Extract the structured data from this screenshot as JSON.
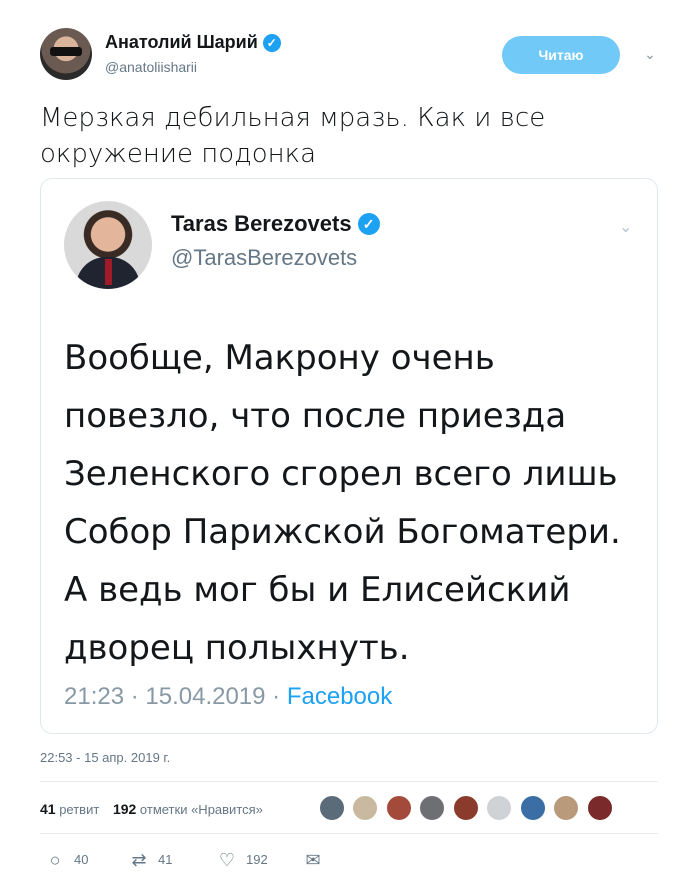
{
  "author": {
    "name": "Анатолий Шарий",
    "handle": "@anatoliisharii",
    "follow_label": "Читаю"
  },
  "tweet": {
    "text": "Мерзкая дебильная мразь. Как и все окружение подонка",
    "timestamp": "22:53 - 15 апр. 2019 г."
  },
  "quoted": {
    "name": "Taras Berezovets",
    "handle": "@TarasBerezovets",
    "body": "Вообще, Макрону очень повезло, что после приезда Зеленского сгорел всего лишь Собор Парижской Богоматери. А ведь мог бы и Елисейский дворец полыхнуть.",
    "meta_time": "21:23 · 15.04.2019 · ",
    "meta_source": "Facebook"
  },
  "stats": {
    "retweets_count": "41",
    "retweets_label": "ретвит",
    "likes_count": "192",
    "likes_label": "отметки «Нравится»"
  },
  "actions": {
    "reply_count": "40",
    "retweet_count": "41",
    "like_count": "192"
  },
  "colors": {
    "accent": "#1da1f2",
    "follow_button": "#71c9f8",
    "secondary_text": "#657786"
  },
  "icons": {
    "verified": "verified-badge-icon",
    "caret": "chevron-down-icon",
    "reply": "reply-icon",
    "retweet": "retweet-icon",
    "like": "heart-icon",
    "dm": "envelope-icon"
  }
}
